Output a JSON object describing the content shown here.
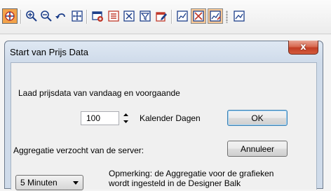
{
  "toolbar": {
    "icons": [
      "crosshair-plus-icon",
      "zoom-in-icon",
      "zoom-out-icon",
      "undo-zoom-icon",
      "fit-window-icon",
      "load-data-icon",
      "list-red-icon",
      "cross-box-icon",
      "filter-box-icon",
      "edit-red-icon",
      "line-chart-icon",
      "chart-crossed-icon",
      "chart-edit-icon",
      "chart-line-small-icon"
    ]
  },
  "dialog": {
    "title": "Start van Prijs Data",
    "close_label": "x",
    "load_label": "Laad prijsdata van vandaag en voorgaande",
    "days_value": "100",
    "days_unit_label": "Kalender Dagen",
    "ok_label": "OK",
    "cancel_label": "Annuleer",
    "aggregation_label": "Aggregatie verzocht van de server:",
    "aggregation_selected": "5 Minuten",
    "note_line1": "Opmerking: de Aggregatie voor de  grafieken",
    "note_line2": "wordt ingesteld in de Designer Balk"
  },
  "colors": {
    "close_red": "#c23e24",
    "pressed_orange": "#f3a34a",
    "default_button_border": "#3c7fb1"
  }
}
